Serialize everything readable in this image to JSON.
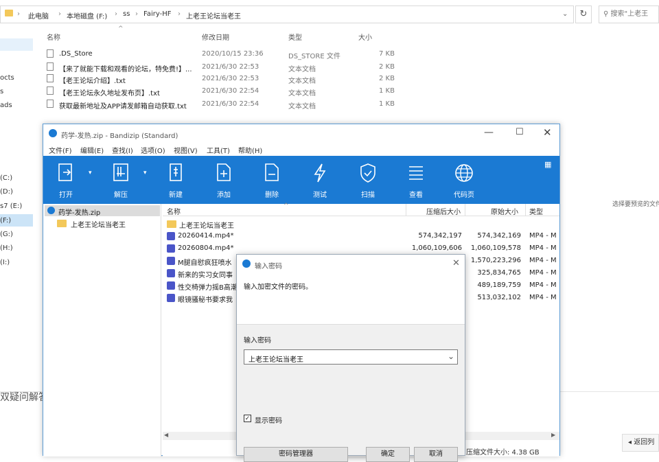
{
  "explorer": {
    "breadcrumb": [
      "此电脑",
      "本地磁盘 (F:)",
      "ss",
      "Fairy-HF",
      "上老王论坛当老王"
    ],
    "search_placeholder": "搜索\"上老王",
    "nav_items": [
      "octs",
      "s",
      "ads",
      "(C:)",
      "(D:)",
      "s7 (E:)",
      "(F:)",
      "(G:)",
      "(H:)",
      "(I:)"
    ],
    "columns": {
      "name": "名称",
      "date": "修改日期",
      "type": "类型",
      "size": "大小"
    },
    "files": [
      {
        "name": ".DS_Store",
        "date": "2020/10/15 23:36",
        "type": "DS_STORE 文件",
        "size": "7 KB"
      },
      {
        "name": "【来了就能下载和观看的论坛，特免费!】...",
        "date": "2021/6/30 22:53",
        "type": "文本文档",
        "size": "2 KB"
      },
      {
        "name": "【老王论坛介绍】.txt",
        "date": "2021/6/30 22:53",
        "type": "文本文档",
        "size": "2 KB"
      },
      {
        "name": "【老王论坛永久地址发布页】.txt",
        "date": "2021/6/30 22:54",
        "type": "文本文档",
        "size": "1 KB"
      },
      {
        "name": "获取最新地址及APP请发邮箱自动获取.txt",
        "date": "2021/6/30 22:54",
        "type": "文本文档",
        "size": "1 KB"
      }
    ],
    "preview_hint": "选择要预览的文件。",
    "bottom_left_text": "双疑问解答",
    "back_button": "◂ 返回列"
  },
  "bandizip": {
    "title": "药学-发热.zip - Bandizip (Standard)",
    "menu": [
      "文件(F)",
      "编辑(E)",
      "查找(I)",
      "选项(O)",
      "视图(V)",
      "工具(T)",
      "帮助(H)"
    ],
    "toolbar": [
      {
        "label": "打开",
        "icon": "open-icon"
      },
      {
        "label": "解压",
        "icon": "extract-icon"
      },
      {
        "label": "新建",
        "icon": "new-archive-icon"
      },
      {
        "label": "添加",
        "icon": "add-file-icon"
      },
      {
        "label": "删除",
        "icon": "delete-file-icon"
      },
      {
        "label": "测试",
        "icon": "lightning-icon"
      },
      {
        "label": "扫描",
        "icon": "shield-icon"
      },
      {
        "label": "查看",
        "icon": "list-view-icon"
      },
      {
        "label": "代码页",
        "icon": "globe-icon"
      }
    ],
    "tree": {
      "root": "药学-发热.zip",
      "child": "上老王论坛当老王"
    },
    "columns": {
      "name": "名称",
      "packed": "压缩后大小",
      "original": "原始大小",
      "type": "类型"
    },
    "rows": [
      {
        "name": "上老王论坛当老王",
        "packed": "",
        "original": "",
        "type": "",
        "kind": "folder"
      },
      {
        "name": "20260414.mp4*",
        "packed": "574,342,197",
        "original": "574,342,169",
        "type": "MP4 - M",
        "kind": "video"
      },
      {
        "name": "20260804.mp4*",
        "packed": "1,060,109,606",
        "original": "1,060,109,578",
        "type": "MP4 - M",
        "kind": "video"
      },
      {
        "name": "M腿自慰疯狂喷水",
        "packed": "",
        "original": "1,570,223,296",
        "type": "MP4 - M",
        "kind": "video"
      },
      {
        "name": "新来的实习女同事",
        "packed": "",
        "original": "325,834,765",
        "type": "MP4 - M",
        "kind": "video"
      },
      {
        "name": "性交椅弹力摇B高潮",
        "packed": "",
        "original": "489,189,759",
        "type": "MP4 - M",
        "kind": "video"
      },
      {
        "name": "眼镜骚秘书要求我",
        "packed": "",
        "original": "513,032,102",
        "type": "MP4 - M",
        "kind": "video"
      }
    ],
    "status": "压缩文件大小: 4.38 GB"
  },
  "dialog": {
    "title": "输入密码",
    "prompt": "输入加密文件的密码。",
    "label": "输入密码",
    "value": "上老王论坛当老王",
    "show_password": "显示密码",
    "buttons": [
      "密码管理器",
      "确定",
      "取消"
    ]
  }
}
